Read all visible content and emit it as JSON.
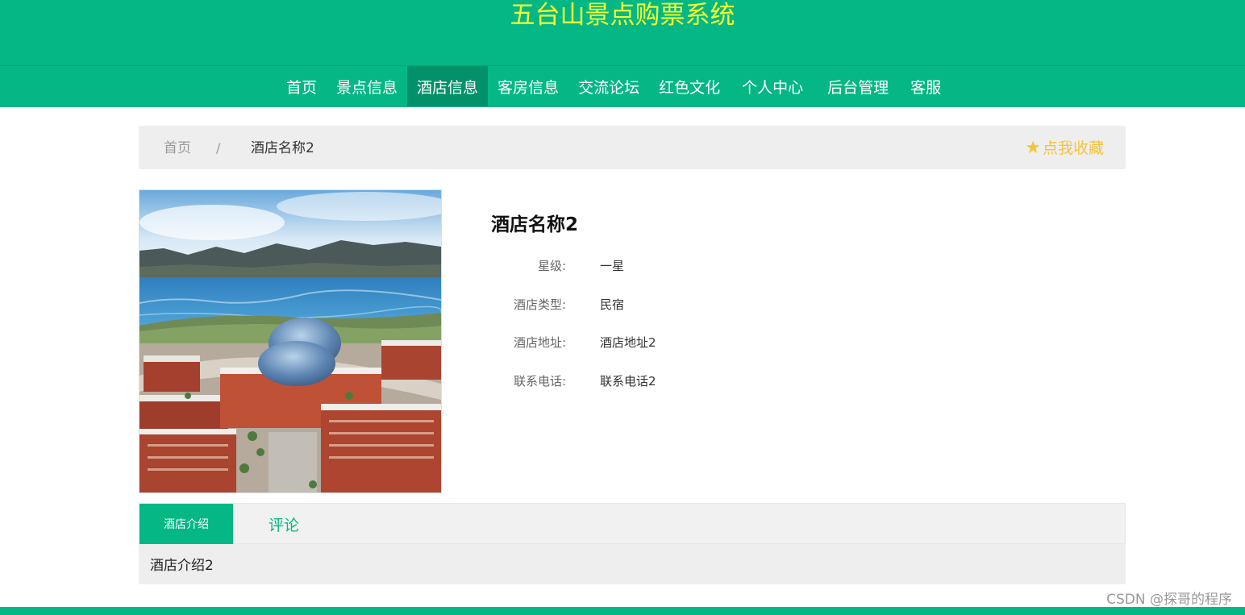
{
  "header": {
    "title": "五台山景点购票系统"
  },
  "nav": {
    "items": [
      {
        "label": "首页"
      },
      {
        "label": "景点信息"
      },
      {
        "label": "酒店信息"
      },
      {
        "label": "客房信息"
      },
      {
        "label": "交流论坛"
      },
      {
        "label": "红色文化"
      },
      {
        "label": "个人中心"
      },
      {
        "label": "后台管理"
      },
      {
        "label": "客服"
      }
    ],
    "active": "酒店信息"
  },
  "breadcrumb": {
    "home": "首页",
    "separator": "/",
    "current": "酒店名称2"
  },
  "favorite": {
    "icon": "star-icon",
    "label": "点我收藏"
  },
  "hotel": {
    "name": "酒店名称2",
    "photo": "hotel-photo",
    "fields": [
      {
        "label": "星级:",
        "value": "一星"
      },
      {
        "label": "酒店类型:",
        "value": "民宿"
      },
      {
        "label": "酒店地址:",
        "value": "酒店地址2"
      },
      {
        "label": "联系电话:",
        "value": "联系电话2"
      }
    ]
  },
  "tabs": {
    "items": [
      {
        "label": "酒店介绍"
      },
      {
        "label": "评论"
      }
    ],
    "active": "酒店介绍",
    "content": "酒店介绍2"
  },
  "watermark": "CSDN @探哥的程序",
  "colors": {
    "primary": "#04b784",
    "primary_dark": "#03916a",
    "title": "#f3ff33",
    "favorite": "#f6c33b",
    "panel": "#eeeeee"
  }
}
